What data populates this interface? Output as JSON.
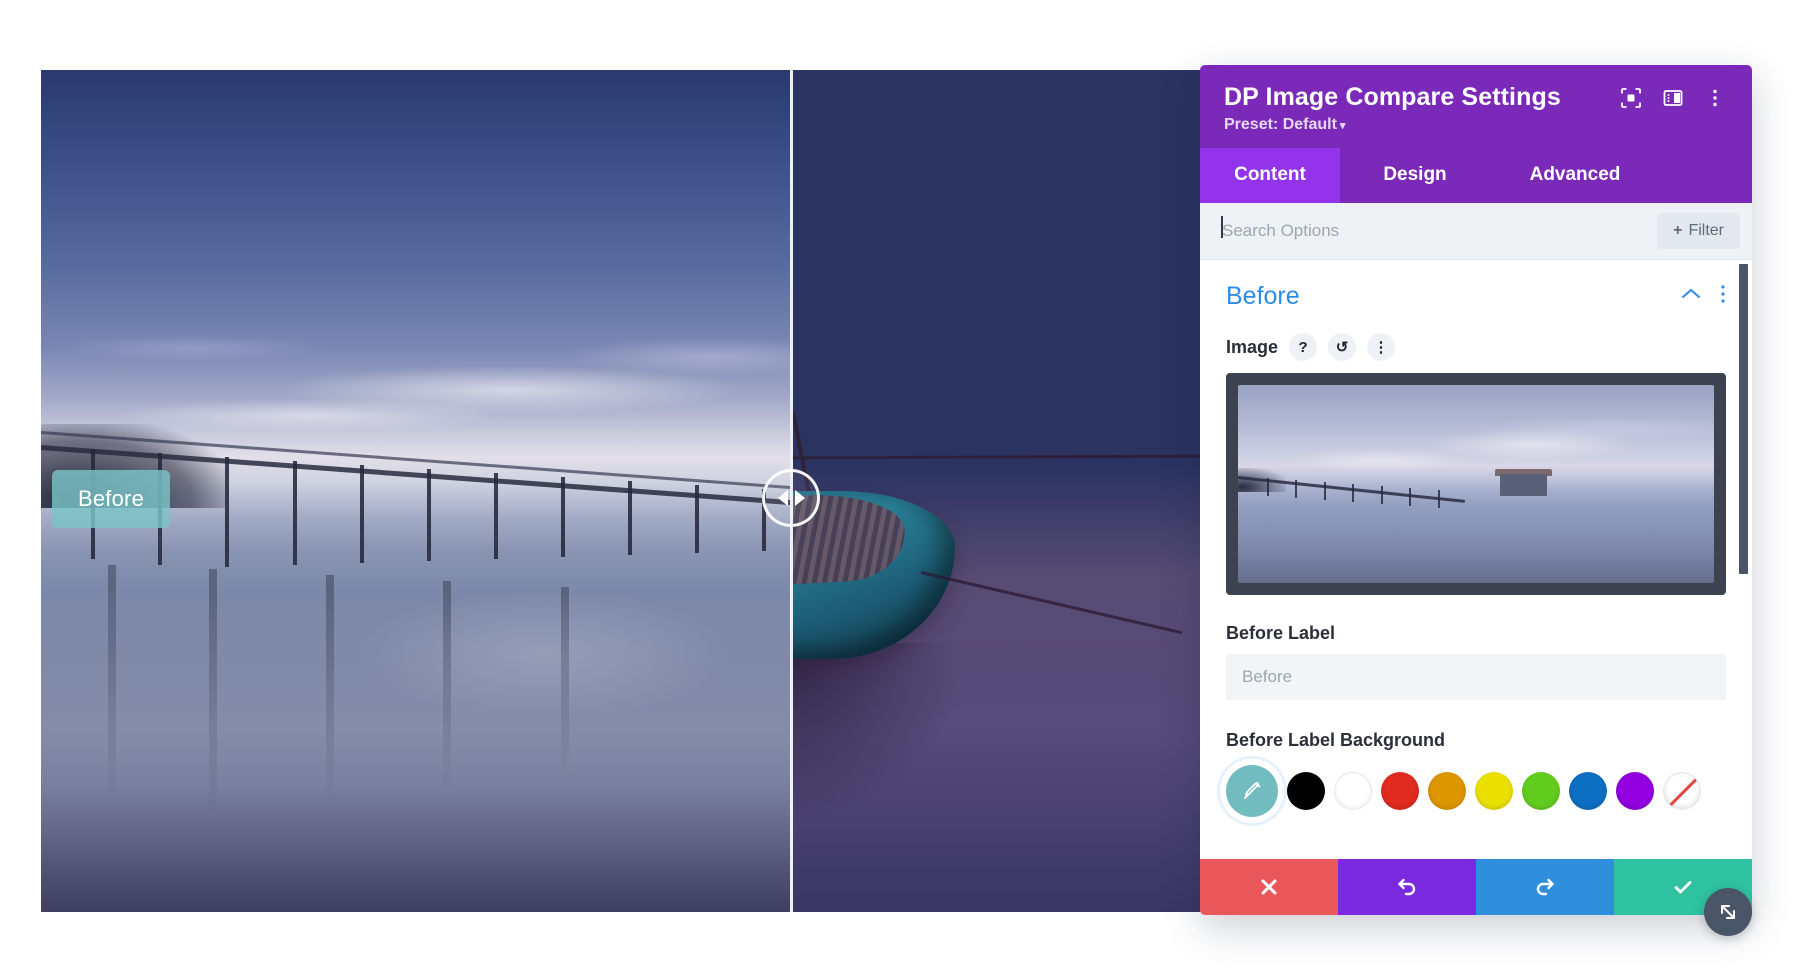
{
  "canvas": {
    "before_badge_label": "Before",
    "slider_handle_icon_left": "triangle-left-icon",
    "slider_handle_icon_right": "triangle-right-icon"
  },
  "panel": {
    "title": "DP Image Compare Settings",
    "preset_label": "Preset: Default",
    "preset_caret": "▾",
    "header_icons": [
      {
        "name": "focus-target-icon"
      },
      {
        "name": "panel-layout-icon"
      },
      {
        "name": "more-vertical-icon"
      }
    ],
    "tabs": [
      {
        "label": "Content",
        "active": true
      },
      {
        "label": "Design",
        "active": false
      },
      {
        "label": "Advanced",
        "active": false
      }
    ],
    "search": {
      "placeholder": "Search Options",
      "value": "",
      "filter_label": "Filter",
      "filter_plus": "+"
    },
    "section": {
      "title": "Before",
      "collapse_icon": "chevron-up-icon",
      "menu_icon": "more-vertical-icon"
    },
    "fields": {
      "image": {
        "label": "Image",
        "help_glyph": "?",
        "reset_glyph": "↺",
        "menu_glyph": "⋮"
      },
      "before_label": {
        "label": "Before Label",
        "value": "",
        "placeholder": "Before"
      },
      "before_label_background": {
        "label": "Before Label Background",
        "selected_index": 0,
        "swatches": [
          {
            "name": "eyedropper-current-color",
            "color": "#72bcc0",
            "selected": true
          },
          {
            "name": "swatch-black",
            "color": "#000000"
          },
          {
            "name": "swatch-white",
            "color": "#ffffff"
          },
          {
            "name": "swatch-red",
            "color": "#e02b20"
          },
          {
            "name": "swatch-orange",
            "color": "#dd9500"
          },
          {
            "name": "swatch-yellow",
            "color": "#eae000"
          },
          {
            "name": "swatch-green",
            "color": "#62cc1f"
          },
          {
            "name": "swatch-blue",
            "color": "#0d6fc2"
          },
          {
            "name": "swatch-purple",
            "color": "#9200e0"
          },
          {
            "name": "swatch-none",
            "color": "transparent"
          }
        ]
      }
    },
    "actions": [
      {
        "name": "cancel-button",
        "glyph": "✖",
        "color": "#e9575a"
      },
      {
        "name": "undo-button",
        "glyph": "↺",
        "color": "#7b29e0"
      },
      {
        "name": "redo-button",
        "glyph": "↻",
        "color": "#2f8fdd"
      },
      {
        "name": "save-button",
        "glyph": "✓",
        "color": "#2ec2a0"
      }
    ],
    "resize_handle_icon": "resize-diagonal-icon"
  }
}
